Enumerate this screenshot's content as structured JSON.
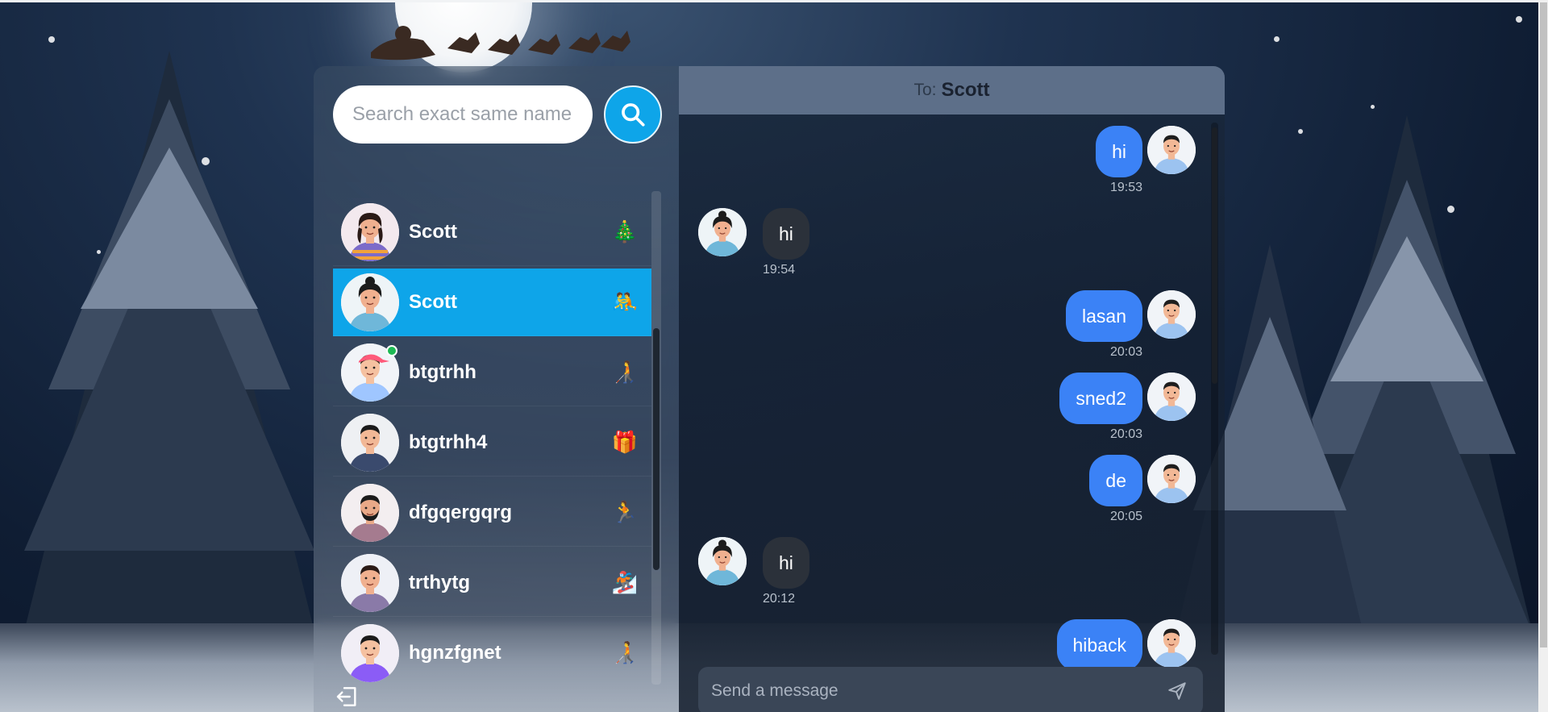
{
  "search": {
    "placeholder": "Search exact same name"
  },
  "contacts": [
    {
      "name": "Scott",
      "emoji": "🎄",
      "active": false,
      "online": false,
      "avatar": "woman-striped"
    },
    {
      "name": "Scott",
      "emoji": "🤼",
      "active": true,
      "online": false,
      "avatar": "woman-bun"
    },
    {
      "name": "btgtrhh",
      "emoji": "🧑‍🦯",
      "active": false,
      "online": true,
      "avatar": "man-cap"
    },
    {
      "name": "btgtrhh4",
      "emoji": "🎁",
      "active": false,
      "online": false,
      "avatar": "man-dark"
    },
    {
      "name": "dfgqergqrg",
      "emoji": "🏃",
      "active": false,
      "online": false,
      "avatar": "man-beard"
    },
    {
      "name": "trthytg",
      "emoji": "🏂",
      "active": false,
      "online": false,
      "avatar": "man-vest"
    },
    {
      "name": "hgnzfgnet",
      "emoji": "🧑‍🦯",
      "active": false,
      "online": false,
      "avatar": "man-purple"
    }
  ],
  "chat": {
    "to_label": "To:",
    "recipient": "Scott",
    "messages": [
      {
        "text": "hi",
        "time": "19:53",
        "direction": "out"
      },
      {
        "text": "hi",
        "time": "19:54",
        "direction": "in"
      },
      {
        "text": "lasan",
        "time": "20:03",
        "direction": "out"
      },
      {
        "text": "sned2",
        "time": "20:03",
        "direction": "out"
      },
      {
        "text": "de",
        "time": "20:05",
        "direction": "out"
      },
      {
        "text": "hi",
        "time": "20:12",
        "direction": "in"
      },
      {
        "text": "hiback",
        "time": "",
        "direction": "out"
      }
    ],
    "composer_placeholder": "Send a message"
  },
  "colors": {
    "accent": "#0ea5e9",
    "bubble_out": "#3b82f6",
    "bubble_in": "#2b313a",
    "header": "#5d6f89"
  },
  "icons": {
    "search": "search-icon",
    "send": "send-icon",
    "logout": "logout-icon"
  }
}
